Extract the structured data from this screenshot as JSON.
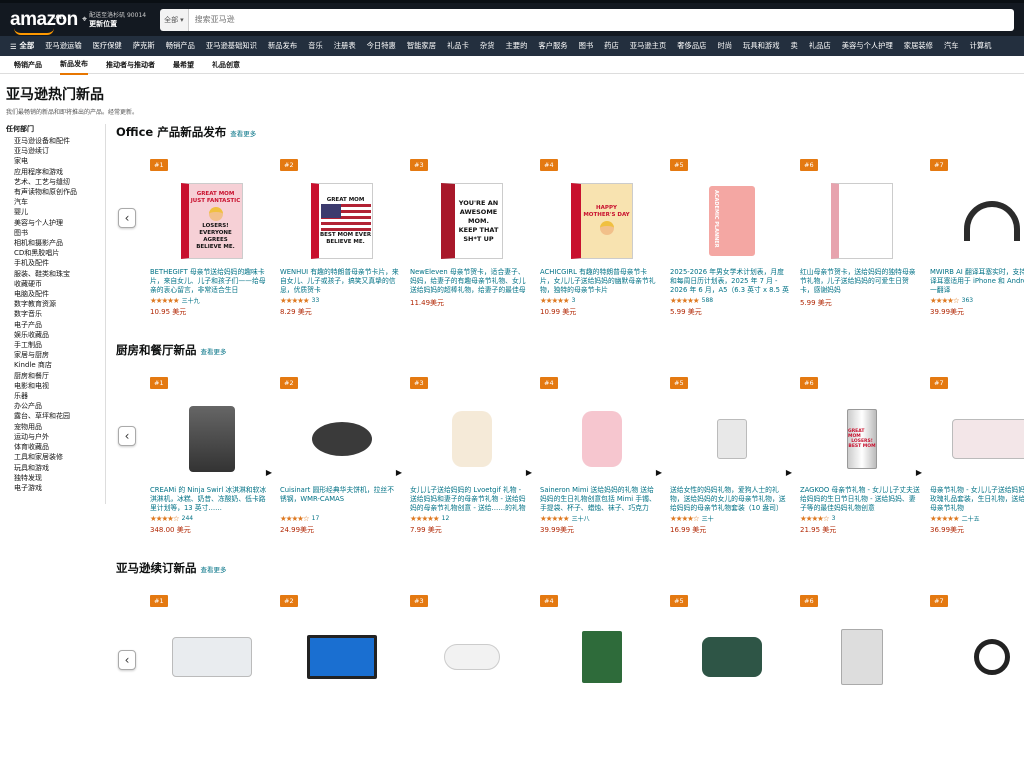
{
  "header": {
    "logo": "amazon",
    "logo_cn": ".cn",
    "location_line1": "配送至洛杉矶 90014",
    "location_line2": "更新位置",
    "search_dept": "全部",
    "search_placeholder": "搜索亚马逊"
  },
  "nav": {
    "all": "全部",
    "items": [
      "亚马逊运输",
      "医疗保健",
      "萨克斯",
      "畅销产品",
      "亚马逊基础知识",
      "新品发布",
      "音乐",
      "注册表",
      "今日特惠",
      "智能家居",
      "礼品卡",
      "杂货",
      "主要的",
      "客户服务",
      "图书",
      "药店",
      "亚马逊主页",
      "奢侈品店",
      "时尚",
      "玩具和游戏",
      "卖",
      "礼品店",
      "美容与个人护理",
      "家居装修",
      "汽车",
      "计算机"
    ]
  },
  "subnav": [
    "畅销产品",
    "新品发布",
    "推动者与推动者",
    "最希望",
    "礼品创意"
  ],
  "page": {
    "title": "亚马逊热门新品",
    "subtitle": "我们最畅销的新品和即将推出的产品。经常更新。"
  },
  "sidebar": {
    "heading": "任何部门",
    "items": [
      "亚马逊设备和配件",
      "亚马逊续订",
      "家电",
      "应用程序和游戏",
      "艺术、工艺与缝纫",
      "有声读物和原创作品",
      "汽车",
      "婴儿",
      "美容与个人护理",
      "图书",
      "相机和摄影产品",
      "CD和黑胶唱片",
      "手机及配件",
      "服装、鞋类和珠宝",
      "收藏硬币",
      "电脑及配件",
      "数字教育资源",
      "数字音乐",
      "电子产品",
      "娱乐收藏品",
      "手工制品",
      "家居与厨房",
      "Kindle 商店",
      "厨房和餐厅",
      "电影和电视",
      "乐器",
      "办公产品",
      "露台、草坪和花园",
      "宠物用品",
      "运动与户外",
      "体育收藏品",
      "工具和家居装修",
      "玩具和游戏",
      "独特发现",
      "电子游戏"
    ]
  },
  "see_more": "查看更多",
  "sections": [
    {
      "title": "Office 产品新品发布",
      "products": [
        {
          "rank": "#1",
          "title": "BETHEGIFT 母亲节送给妈妈的趣味卡片，来自女儿、儿子和孩子们——给母亲的衷心留言，非常适合生日",
          "stars": "★★★★★",
          "rating": "三十九",
          "price": "10.95 美元"
        },
        {
          "rank": "#2",
          "title": "WENHUI 有趣的特朗普母亲节卡片，来自女儿、儿子或孩子，搞笑又真挚的信息，优质贺卡",
          "stars": "★★★★★",
          "rating": "33",
          "price": "8.29 美元"
        },
        {
          "rank": "#3",
          "title": "NewEleven 母亲节贺卡，适合妻子、妈妈，给妻子的有趣母亲节礼物、女儿送给妈妈的超棒礼物，给妻子的最佳母亲节礼物创意",
          "stars": "",
          "rating": "",
          "price": "11.49美元"
        },
        {
          "rank": "#4",
          "title": "ACHICGIRL 有趣的特朗普母亲节卡片，女儿儿子送给妈妈的幽默母亲节礼物，独特的母亲节卡片",
          "stars": "★★★★★",
          "rating": "3",
          "price": "10.99 美元"
        },
        {
          "rank": "#5",
          "title": "2025-2026 年男女学术计划表，月度和每周日历计划表，2025 年 7 月 - 2026 年 6 月，A5（6.3 英寸 x 8.5 英寸）。",
          "stars": "★★★★★",
          "rating": "588",
          "price": "5.99 美元"
        },
        {
          "rank": "#6",
          "title": "红山母亲节贺卡，送给妈妈的独特母亲节礼物，儿子送给妈妈的可爱生日贺卡，感谢妈妈",
          "stars": "",
          "rating": "",
          "price": "5.99 美元"
        },
        {
          "rank": "#7",
          "title": "MWIRB AI 翻译耳塞实时，支持语言翻译耳塞适用于 iPhone 和 Android 三合一翻译",
          "stars": "★★★★☆",
          "rating": "363",
          "price": "39.99美元"
        }
      ]
    },
    {
      "title": "厨房和餐厅新品",
      "products": [
        {
          "rank": "#1",
          "title": "CREAMi 的 Ninja Swirl 冰淇淋和软冰淇淋机，冰糕、奶昔、冻酸奶、低卡路里计划等，13 英寸……",
          "stars": "★★★★☆",
          "rating": "244",
          "price": "348.00 美元"
        },
        {
          "rank": "#2",
          "title": "Cuisinart 圆形经典华夫饼机，拉丝不锈钢，WMR-CAMAS",
          "stars": "★★★★☆",
          "rating": "17",
          "price": "24.99美元"
        },
        {
          "rank": "#3",
          "title": "女儿儿子送给妈妈的 Lvoetgif 礼物 - 送给妈妈和妻子的母亲节礼物 - 送给妈妈的母亲节礼物创意 - 送给……的礼物",
          "stars": "★★★★★",
          "rating": "12",
          "price": "7.99 美元"
        },
        {
          "rank": "#4",
          "title": "Saineron Mimi 送给妈妈的礼物 送给妈妈的生日礼物创意包括 Mimi 手镯、手提袋、杯子、蜡烛、袜子、巧克力",
          "stars": "★★★★★",
          "rating": "三十八",
          "price": "39.99美元"
        },
        {
          "rank": "#5",
          "title": "送给女性的妈妈礼物，爱狗人士的礼物，送给妈妈的女儿的母亲节礼物，送给妈妈的母亲节礼物套装（10 盎司）",
          "stars": "★★★★☆",
          "rating": "三十",
          "price": "16.99 美元"
        },
        {
          "rank": "#6",
          "title": "ZAGKOO 母亲节礼物 - 女儿儿子丈夫送给妈妈的生日节日礼物 - 送给妈妈、妻子等的最佳妈妈礼物创意",
          "stars": "★★★★☆",
          "rating": "3",
          "price": "21.95 美元"
        },
        {
          "rank": "#7",
          "title": "母亲节礼物 - 女儿儿子送给妈妈的优雅玫瑰礼品套装，生日礼物，送给妈妈的母亲节礼物",
          "stars": "★★★★★",
          "rating": "二十五",
          "price": "36.99美元"
        }
      ]
    },
    {
      "title": "亚马逊续订新品",
      "products": [
        {
          "rank": "#1"
        },
        {
          "rank": "#2"
        },
        {
          "rank": "#3"
        },
        {
          "rank": "#4"
        },
        {
          "rank": "#5"
        },
        {
          "rank": "#6"
        },
        {
          "rank": "#7"
        }
      ]
    }
  ],
  "card_text": {
    "s0p0": [
      "GREAT MOM",
      "JUST FANTASTIC",
      "LOSERS!",
      "EVERYONE AGREES",
      "BELIEVE ME."
    ],
    "s0p1": [
      "GREAT MOM",
      "BEST MOM EVER",
      "BELIEVE ME."
    ],
    "s0p2": [
      "YOU'RE AN",
      "AWESOME",
      "MOM.",
      "KEEP THAT",
      "SH*T UP"
    ],
    "s0p3": [
      "HAPPY MOTHER'S DAY"
    ],
    "s0p4": [
      "ACADEMIC PLANNER"
    ],
    "s1p5": [
      "GREAT MOM",
      "LOSERS!",
      "BEST MOM"
    ]
  },
  "colors": {
    "topbar": "#131921",
    "navbar": "#232f3e",
    "accent": "#ff9900",
    "badge": "#e47911",
    "link": "#007185",
    "price": "#b12704",
    "star": "#de7921"
  }
}
